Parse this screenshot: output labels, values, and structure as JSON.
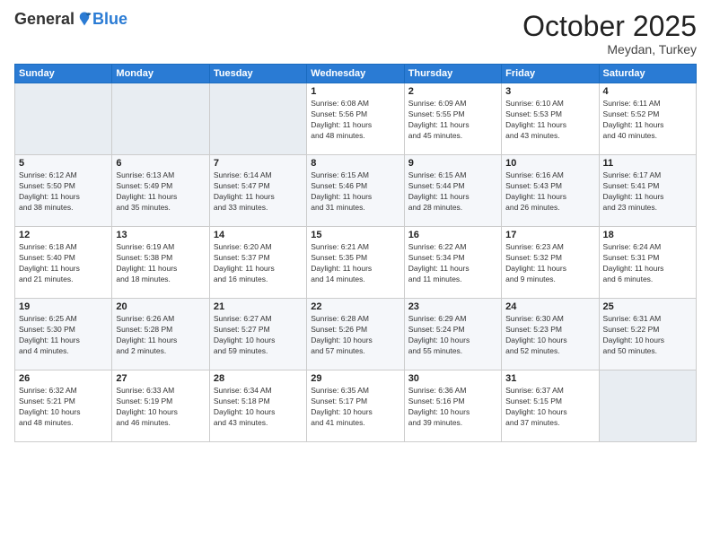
{
  "header": {
    "logo_general": "General",
    "logo_blue": "Blue",
    "month": "October 2025",
    "location": "Meydan, Turkey"
  },
  "days_of_week": [
    "Sunday",
    "Monday",
    "Tuesday",
    "Wednesday",
    "Thursday",
    "Friday",
    "Saturday"
  ],
  "weeks": [
    [
      {
        "day": "",
        "info": ""
      },
      {
        "day": "",
        "info": ""
      },
      {
        "day": "",
        "info": ""
      },
      {
        "day": "1",
        "info": "Sunrise: 6:08 AM\nSunset: 5:56 PM\nDaylight: 11 hours\nand 48 minutes."
      },
      {
        "day": "2",
        "info": "Sunrise: 6:09 AM\nSunset: 5:55 PM\nDaylight: 11 hours\nand 45 minutes."
      },
      {
        "day": "3",
        "info": "Sunrise: 6:10 AM\nSunset: 5:53 PM\nDaylight: 11 hours\nand 43 minutes."
      },
      {
        "day": "4",
        "info": "Sunrise: 6:11 AM\nSunset: 5:52 PM\nDaylight: 11 hours\nand 40 minutes."
      }
    ],
    [
      {
        "day": "5",
        "info": "Sunrise: 6:12 AM\nSunset: 5:50 PM\nDaylight: 11 hours\nand 38 minutes."
      },
      {
        "day": "6",
        "info": "Sunrise: 6:13 AM\nSunset: 5:49 PM\nDaylight: 11 hours\nand 35 minutes."
      },
      {
        "day": "7",
        "info": "Sunrise: 6:14 AM\nSunset: 5:47 PM\nDaylight: 11 hours\nand 33 minutes."
      },
      {
        "day": "8",
        "info": "Sunrise: 6:15 AM\nSunset: 5:46 PM\nDaylight: 11 hours\nand 31 minutes."
      },
      {
        "day": "9",
        "info": "Sunrise: 6:15 AM\nSunset: 5:44 PM\nDaylight: 11 hours\nand 28 minutes."
      },
      {
        "day": "10",
        "info": "Sunrise: 6:16 AM\nSunset: 5:43 PM\nDaylight: 11 hours\nand 26 minutes."
      },
      {
        "day": "11",
        "info": "Sunrise: 6:17 AM\nSunset: 5:41 PM\nDaylight: 11 hours\nand 23 minutes."
      }
    ],
    [
      {
        "day": "12",
        "info": "Sunrise: 6:18 AM\nSunset: 5:40 PM\nDaylight: 11 hours\nand 21 minutes."
      },
      {
        "day": "13",
        "info": "Sunrise: 6:19 AM\nSunset: 5:38 PM\nDaylight: 11 hours\nand 18 minutes."
      },
      {
        "day": "14",
        "info": "Sunrise: 6:20 AM\nSunset: 5:37 PM\nDaylight: 11 hours\nand 16 minutes."
      },
      {
        "day": "15",
        "info": "Sunrise: 6:21 AM\nSunset: 5:35 PM\nDaylight: 11 hours\nand 14 minutes."
      },
      {
        "day": "16",
        "info": "Sunrise: 6:22 AM\nSunset: 5:34 PM\nDaylight: 11 hours\nand 11 minutes."
      },
      {
        "day": "17",
        "info": "Sunrise: 6:23 AM\nSunset: 5:32 PM\nDaylight: 11 hours\nand 9 minutes."
      },
      {
        "day": "18",
        "info": "Sunrise: 6:24 AM\nSunset: 5:31 PM\nDaylight: 11 hours\nand 6 minutes."
      }
    ],
    [
      {
        "day": "19",
        "info": "Sunrise: 6:25 AM\nSunset: 5:30 PM\nDaylight: 11 hours\nand 4 minutes."
      },
      {
        "day": "20",
        "info": "Sunrise: 6:26 AM\nSunset: 5:28 PM\nDaylight: 11 hours\nand 2 minutes."
      },
      {
        "day": "21",
        "info": "Sunrise: 6:27 AM\nSunset: 5:27 PM\nDaylight: 10 hours\nand 59 minutes."
      },
      {
        "day": "22",
        "info": "Sunrise: 6:28 AM\nSunset: 5:26 PM\nDaylight: 10 hours\nand 57 minutes."
      },
      {
        "day": "23",
        "info": "Sunrise: 6:29 AM\nSunset: 5:24 PM\nDaylight: 10 hours\nand 55 minutes."
      },
      {
        "day": "24",
        "info": "Sunrise: 6:30 AM\nSunset: 5:23 PM\nDaylight: 10 hours\nand 52 minutes."
      },
      {
        "day": "25",
        "info": "Sunrise: 6:31 AM\nSunset: 5:22 PM\nDaylight: 10 hours\nand 50 minutes."
      }
    ],
    [
      {
        "day": "26",
        "info": "Sunrise: 6:32 AM\nSunset: 5:21 PM\nDaylight: 10 hours\nand 48 minutes."
      },
      {
        "day": "27",
        "info": "Sunrise: 6:33 AM\nSunset: 5:19 PM\nDaylight: 10 hours\nand 46 minutes."
      },
      {
        "day": "28",
        "info": "Sunrise: 6:34 AM\nSunset: 5:18 PM\nDaylight: 10 hours\nand 43 minutes."
      },
      {
        "day": "29",
        "info": "Sunrise: 6:35 AM\nSunset: 5:17 PM\nDaylight: 10 hours\nand 41 minutes."
      },
      {
        "day": "30",
        "info": "Sunrise: 6:36 AM\nSunset: 5:16 PM\nDaylight: 10 hours\nand 39 minutes."
      },
      {
        "day": "31",
        "info": "Sunrise: 6:37 AM\nSunset: 5:15 PM\nDaylight: 10 hours\nand 37 minutes."
      },
      {
        "day": "",
        "info": ""
      }
    ]
  ]
}
